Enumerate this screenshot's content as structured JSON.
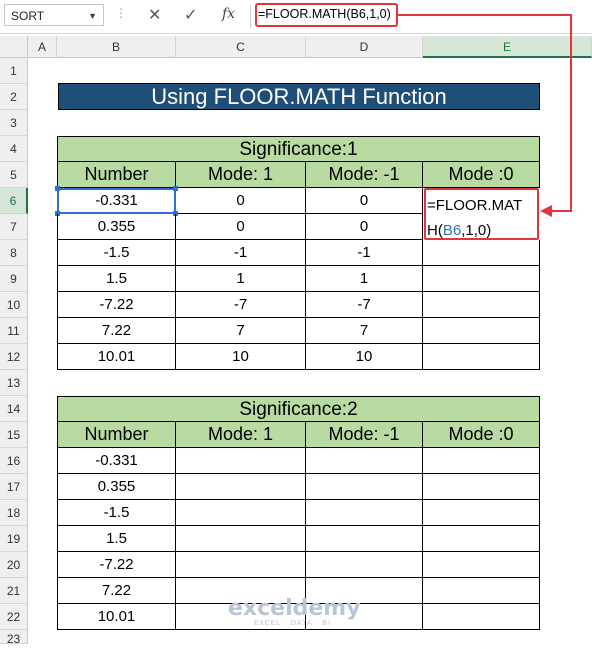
{
  "name_box": "SORT",
  "formula_bar": "=FLOOR.MATH(B6,1,0)",
  "columns": [
    "A",
    "B",
    "C",
    "D",
    "E"
  ],
  "rows": [
    "1",
    "2",
    "3",
    "4",
    "5",
    "6",
    "7",
    "8",
    "9",
    "10",
    "11",
    "12",
    "13",
    "14",
    "15",
    "16",
    "17",
    "18",
    "19",
    "20",
    "21",
    "22",
    "23"
  ],
  "title": "Using FLOOR.MATH Function",
  "table1": {
    "significance": "Significance:1",
    "headers": [
      "Number",
      "Mode: 1",
      "Mode: -1",
      "Mode :0"
    ],
    "rows": [
      [
        "-0.331",
        "0",
        "0"
      ],
      [
        "0.355",
        "0",
        "0"
      ],
      [
        "-1.5",
        "-1",
        "-1"
      ],
      [
        "1.5",
        "1",
        "1"
      ],
      [
        "-7.22",
        "-7",
        "-7"
      ],
      [
        "7.22",
        "7",
        "7"
      ],
      [
        "10.01",
        "10",
        "10"
      ]
    ],
    "edit_line1": "=FLOOR.MAT",
    "edit_line2_a": "H(",
    "edit_line2_ref": "B6",
    "edit_line2_b": ",1,0)"
  },
  "table2": {
    "significance": "Significance:2",
    "headers": [
      "Number",
      "Mode: 1",
      "Mode: -1",
      "Mode :0"
    ],
    "numbers": [
      "-0.331",
      "0.355",
      "-1.5",
      "1.5",
      "-7.22",
      "7.22",
      "10.01"
    ]
  },
  "watermark": "exceldemy",
  "watermark_sub": "EXCEL · DATA · BI",
  "icons": [
    "dropdown-icon",
    "cancel-icon",
    "enter-icon",
    "function-icon"
  ],
  "colors": {
    "title_bg": "#1f4e79",
    "header_bg": "#b7dba0",
    "highlight": "#e2363c",
    "selection": "#217346"
  }
}
